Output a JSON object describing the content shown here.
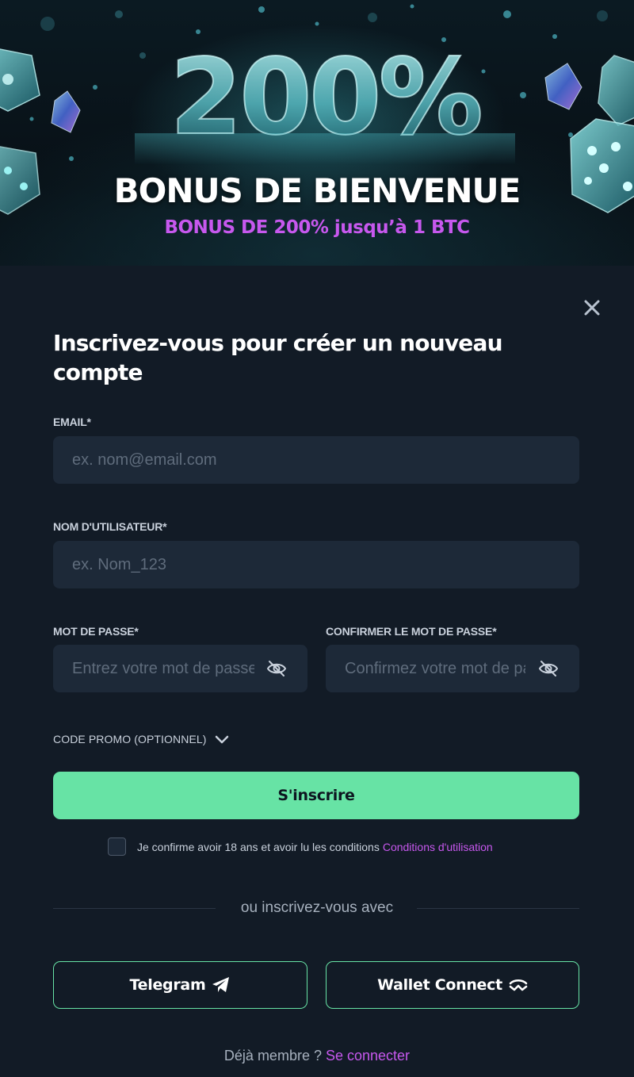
{
  "banner": {
    "graphic_text": "200%",
    "title": "BONUS DE BIENVENUE",
    "subtitle": "BONUS DE 200% jusqu’à 1 BTC"
  },
  "form": {
    "title": "Inscrivez-vous pour créer un nouveau compte",
    "email": {
      "label": "EMAIL*",
      "placeholder": "ex. nom@email.com",
      "value": ""
    },
    "username": {
      "label": "NOM D'UTILISATEUR*",
      "placeholder": "ex. Nom_123",
      "value": ""
    },
    "password": {
      "label": "MOT DE PASSE*",
      "placeholder": "Entrez votre mot de passe",
      "value": ""
    },
    "confirm_password": {
      "label": "CONFIRMER LE MOT DE PASSE*",
      "placeholder": "Confirmez votre mot de passe",
      "value": ""
    },
    "promo": {
      "label": "CODE PROMO (OPTIONNEL)"
    },
    "submit_label": "S'inscrire",
    "terms": {
      "checked": false,
      "text": "Je confirme avoir 18 ans et avoir lu les conditions",
      "link": "Conditions d'utilisation"
    }
  },
  "divider_text": "ou inscrivez-vous avec",
  "social": {
    "telegram_label": "Telegram",
    "walletconnect_label": "Wallet Connect"
  },
  "footer": {
    "text": "Déjà membre ?",
    "link": "Se connecter"
  },
  "colors": {
    "background": "#121b26",
    "field": "#1d2938",
    "accent_green": "#67e3a5",
    "accent_purple": "#c758ee"
  },
  "icons": [
    "close-icon",
    "eye-off-icon",
    "chevron-down-icon",
    "telegram-icon",
    "walletconnect-icon",
    "dice-icon",
    "crystal-icon"
  ]
}
